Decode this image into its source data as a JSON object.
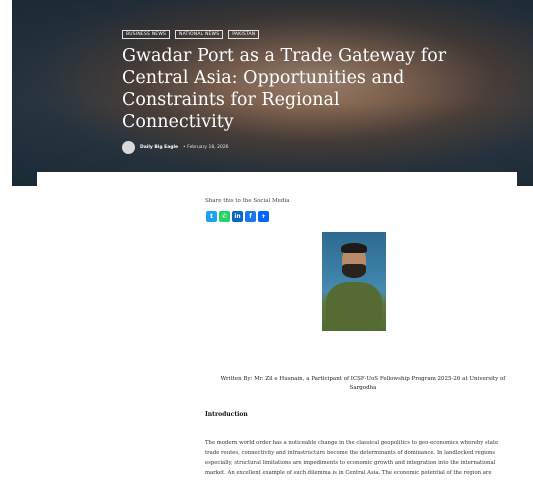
{
  "hero": {
    "tags": [
      "Business News",
      "National News",
      "Pakistan"
    ],
    "title": "Gwadar Port as a Trade Gateway for Central Asia: Opportunities and Constraints for Regional Connectivity",
    "author": "Daily Big Eagle",
    "date": "February 18, 2026"
  },
  "share": {
    "label": "Share this to the Social Media",
    "icons": [
      "twitter-icon",
      "whatsapp-icon",
      "linkedin-icon",
      "facebook-icon",
      "share-icon"
    ]
  },
  "article": {
    "written_by": "Written By: Mr. Zil e Husnain, a Participant of ICSF-UoS Fellowship Program 2025-26 at University of Sargodha",
    "intro_heading": "Introduction",
    "paragraph": "The modern world order has a noticeable change in the classical geopolitics to geo-economics whereby state trade routes, connectivity and infrastructure become the determinants of dominance. In landlocked regions especially, structural limitations are impediments to economic growth and integration into the international market. An excellent example of such dilemma is in Central Asia. The economic potential of the region are"
  }
}
